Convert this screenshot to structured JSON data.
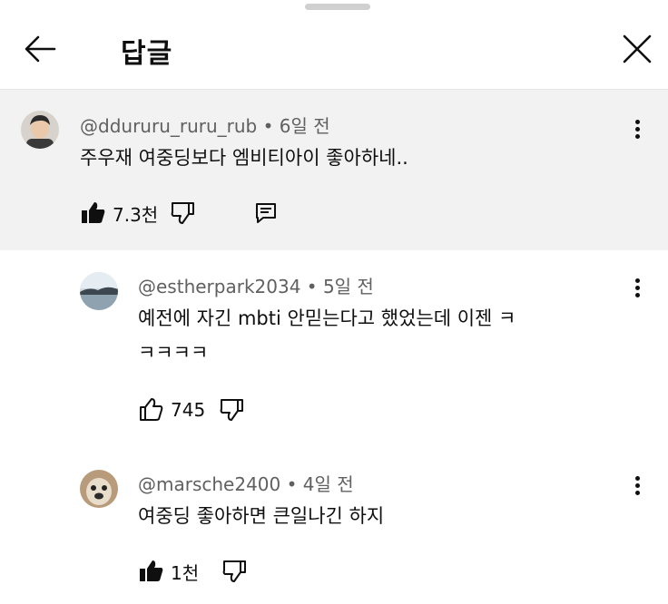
{
  "header": {
    "title": "답글"
  },
  "comments": [
    {
      "handle": "@ddururu_ruru_rub",
      "time": "6일 전",
      "lines": [
        "주우재 여중딩보다 엠비티아이 좋아하네.."
      ],
      "likes": "7.3천"
    },
    {
      "handle": "@estherpark2034",
      "time": "5일 전",
      "lines": [
        "예전에 자긴 mbti 안믿는다고 했었는데 이젠 ㅋ",
        "ㅋㅋㅋㅋ"
      ],
      "likes": "745"
    },
    {
      "handle": "@marsche2400",
      "time": "4일 전",
      "lines": [
        "여중딩 좋아하면 큰일나긴 하지"
      ],
      "likes": "1천"
    }
  ],
  "separator": "•",
  "icons": {
    "back": "arrow-left-icon",
    "close": "close-icon",
    "like_filled": "thumb-up-filled-icon",
    "like_outline": "thumb-up-outline-icon",
    "dislike": "thumb-down-outline-icon",
    "reply": "reply-icon",
    "more": "more-vertical-icon"
  },
  "colors": {
    "highlight_bg": "#f2f2f2",
    "meta_text": "#606060",
    "text": "#0f0f0f"
  }
}
